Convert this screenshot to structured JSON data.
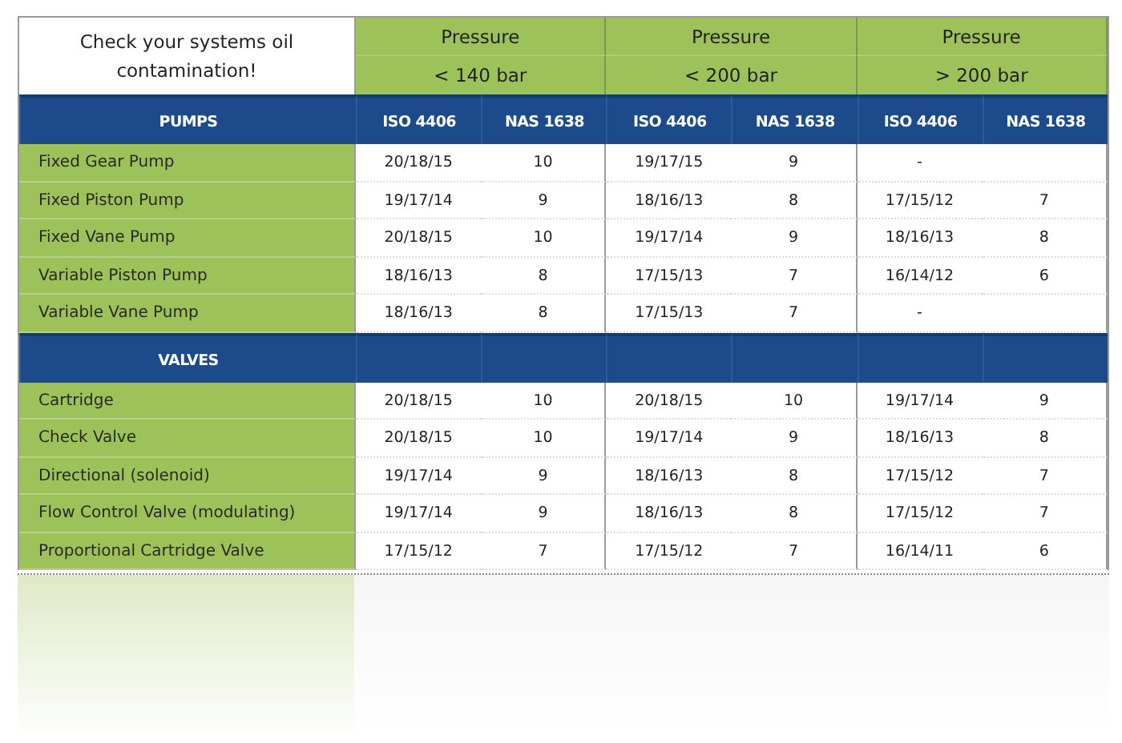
{
  "title": "Check your systems oil contamination!",
  "pressure_groups": [
    {
      "label": "Pressure",
      "range": "< 140 bar"
    },
    {
      "label": "Pressure",
      "range": "< 200 bar"
    },
    {
      "label": "Pressure",
      "range": "> 200 bar"
    }
  ],
  "sections": [
    {
      "name": "PUMPS",
      "columns": [
        "ISO 4406",
        "NAS 1638",
        "ISO 4406",
        "NAS 1638",
        "ISO 4406",
        "NAS 1638"
      ],
      "rows": [
        {
          "label": "Fixed Gear Pump",
          "cells": [
            "20/18/15",
            "10",
            "19/17/15",
            "9",
            "-",
            null
          ]
        },
        {
          "label": "Fixed Piston Pump",
          "cells": [
            "19/17/14",
            "9",
            "18/16/13",
            "8",
            "17/15/12",
            "7"
          ]
        },
        {
          "label": "Fixed Vane Pump",
          "cells": [
            "20/18/15",
            "10",
            "19/17/14",
            "9",
            "18/16/13",
            "8"
          ]
        },
        {
          "label": "Variable Piston Pump",
          "cells": [
            "18/16/13",
            "8",
            "17/15/13",
            "7",
            "16/14/12",
            "6"
          ]
        },
        {
          "label": "Variable Vane Pump",
          "cells": [
            "18/16/13",
            "8",
            "17/15/13",
            "7",
            "-",
            null
          ]
        }
      ]
    },
    {
      "name": "VALVES",
      "rows": [
        {
          "label": "Cartridge",
          "cells": [
            "20/18/15",
            "10",
            "20/18/15",
            "10",
            "19/17/14",
            "9"
          ]
        },
        {
          "label": "Check Valve",
          "cells": [
            "20/18/15",
            "10",
            "19/17/14",
            "9",
            "18/16/13",
            "8"
          ]
        },
        {
          "label": "Directional (solenoid)",
          "cells": [
            "19/17/14",
            "9",
            "18/16/13",
            "8",
            "17/15/12",
            "7"
          ]
        },
        {
          "label": "Flow Control Valve (modulating)",
          "cells": [
            "19/17/14",
            "9",
            "18/16/13",
            "8",
            "17/15/12",
            "7"
          ]
        },
        {
          "label": "Proportional Cartridge Valve",
          "cells": [
            "17/15/12",
            "7",
            "17/15/12",
            "7",
            "16/14/11",
            "6"
          ]
        }
      ]
    }
  ]
}
